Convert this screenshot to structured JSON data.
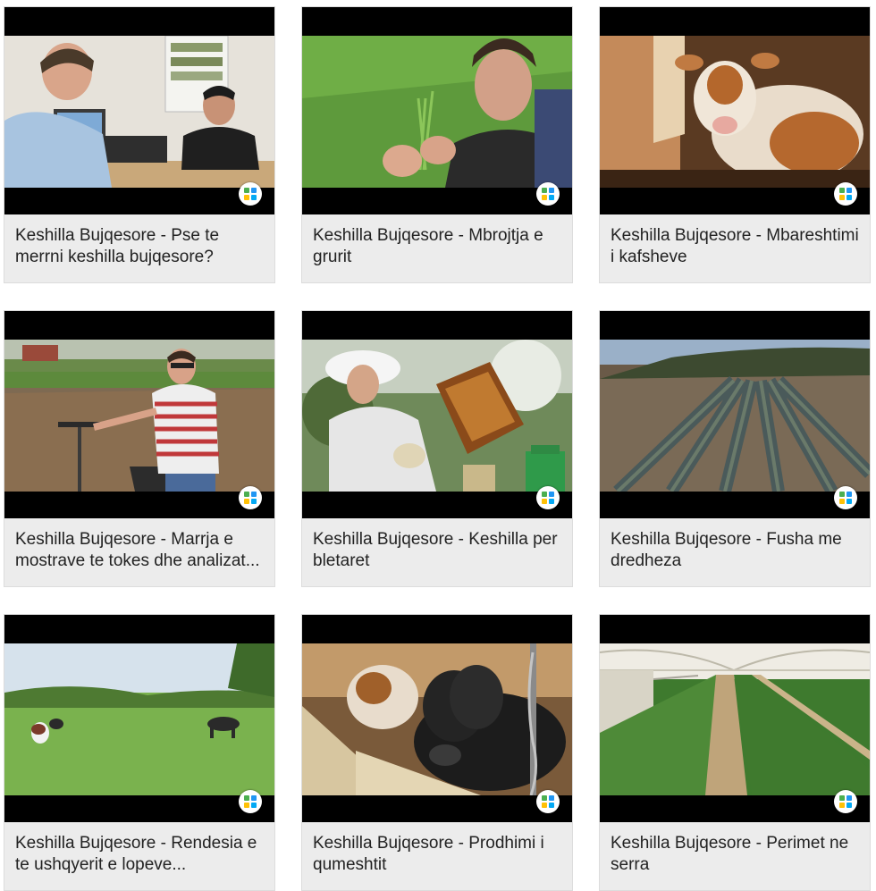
{
  "videos": [
    {
      "title": "Keshilla Bujqesore - Pse te merrni keshilla bujqesore?"
    },
    {
      "title": "Keshilla Bujqesore - Mbrojtja e grurit"
    },
    {
      "title": "Keshilla Bujqesore - Mbareshtimi i kafsheve"
    },
    {
      "title": "Keshilla Bujqesore - Marrja e mostrave te tokes dhe analizat..."
    },
    {
      "title": "Keshilla Bujqesore - Keshilla per bletaret"
    },
    {
      "title": "Keshilla Bujqesore - Fusha me dredheza"
    },
    {
      "title": "Keshilla Bujqesore - Rendesia e te ushqyerit e lopeve..."
    },
    {
      "title": "Keshilla Bujqesore - Prodhimi i qumeshtit"
    },
    {
      "title": "Keshilla Bujqesore - Perimet ne serra"
    }
  ],
  "logo_icon": "channel-logo-icon",
  "colors": {
    "card_bg": "#ececec",
    "letterbox": "#000000",
    "title_text": "#222222"
  }
}
